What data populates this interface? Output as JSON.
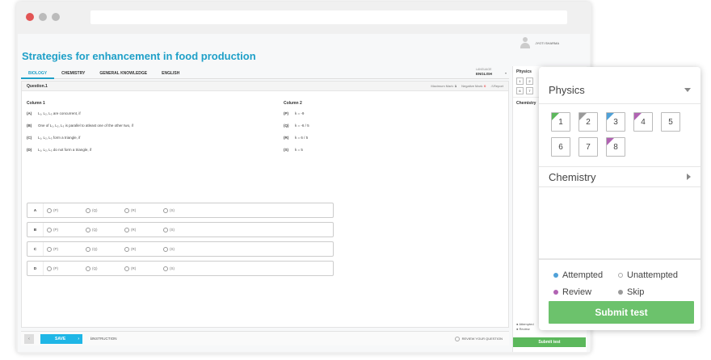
{
  "user": {
    "name": "JYOTI SHARMA"
  },
  "test": {
    "title": "Strategies for enhancement in food production"
  },
  "subjects": [
    "BIOLOGY",
    "CHEMISTRY",
    "GENERAL KNOWLEDGE",
    "ENGLISH"
  ],
  "language": {
    "label": "LANGUAGE",
    "value": "ENGLISH"
  },
  "question": {
    "number": "Question.1",
    "max_mark_label": "Maximum Mark:",
    "max_mark": "1",
    "neg_mark_label": "Negative Mark:",
    "neg_mark": "0",
    "report": "Report",
    "column1_title": "Column 1",
    "column2_title": "Column 2",
    "column1": [
      {
        "key": "(A)",
        "text": "L₁, L₂, L₃ are concurrent, if"
      },
      {
        "key": "(B)",
        "text": "One of L₁, L₂, L₃ is parallel to atleast one of the other two, if"
      },
      {
        "key": "(C)",
        "text": "L₁, L₂, L₃ form a triangle, if"
      },
      {
        "key": "(D)",
        "text": "L₁, L₂, L₃ do not form a triangle, if"
      }
    ],
    "column2": [
      {
        "key": "(P)",
        "text": "k = -9"
      },
      {
        "key": "(Q)",
        "text": "k = -6 / 5"
      },
      {
        "key": "(R)",
        "text": "k = 6 / 5"
      },
      {
        "key": "(S)",
        "text": "k = 5"
      }
    ],
    "option_rows": [
      "A",
      "B",
      "C",
      "D"
    ],
    "option_choices": [
      "(P)",
      "(Q)",
      "(R)",
      "(S)"
    ]
  },
  "footer": {
    "save": "SAVE",
    "instruction": "INSTRUCTION",
    "review": "REVIEW YOUR QUESTION"
  },
  "sidebar": {
    "physics": "Physics",
    "chemistry": "Chemistry",
    "attempted": "Attempted",
    "review": "Review",
    "unattempted": "Unattempted",
    "skip": "Skip",
    "submit": "Submit test",
    "questions": [
      "1",
      "2",
      "3",
      "4",
      "5",
      "6",
      "7",
      "8"
    ],
    "question_status": [
      "attempted",
      "skip",
      "review",
      "review",
      "unattempted",
      "unattempted",
      "unattempted",
      "review"
    ]
  },
  "colors": {
    "accent": "#1fa0c8",
    "attempted": "#4fa1d8",
    "review": "#b163b3",
    "skip": "#9a9a9a",
    "attempted_tri": "#5cb85c",
    "submit": "#6cc26c"
  }
}
